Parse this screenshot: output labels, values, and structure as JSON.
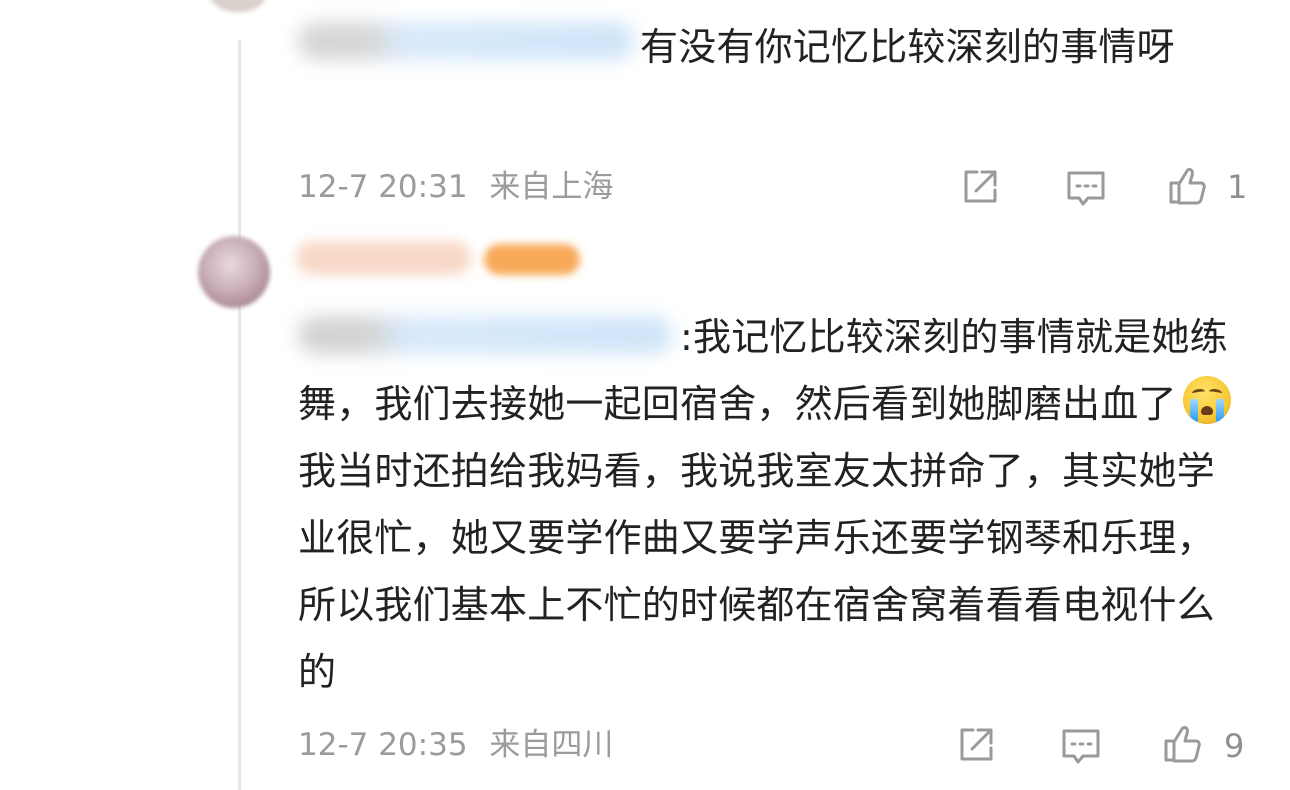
{
  "comments": [
    {
      "text": "有没有你记忆比较深刻的事情呀",
      "date": "12-7 20:31",
      "location": "来自上海",
      "likes": "1",
      "icons": {
        "share": "share-external-icon",
        "comment": "comment-icon",
        "like": "thumbs-up-icon"
      }
    },
    {
      "text_before_emoji": ":我记忆比较深刻的事情就是她练舞，我们去接她一起回宿舍，然后看到她脚磨出血了",
      "emoji": "crying-face-emoji",
      "text_after_emoji": "我当时还拍给我妈看，我说我室友太拼命了，其实她学业很忙，她又要学作曲又要学声乐还要学钢琴和乐理，所以我们基本上不忙的时候都在宿舍窝着看看电视什么的",
      "date": "12-7 20:35",
      "location": "来自四川",
      "likes": "9",
      "icons": {
        "share": "share-external-icon",
        "comment": "comment-icon",
        "like": "thumbs-up-icon"
      }
    }
  ],
  "colors": {
    "text": "#222222",
    "meta": "#9b9b9b",
    "icon": "#9a9a9a",
    "thread_line": "#e8e8e8",
    "blurred_mention": "#cfe4f8",
    "blurred_badge": "#f8aa59"
  }
}
